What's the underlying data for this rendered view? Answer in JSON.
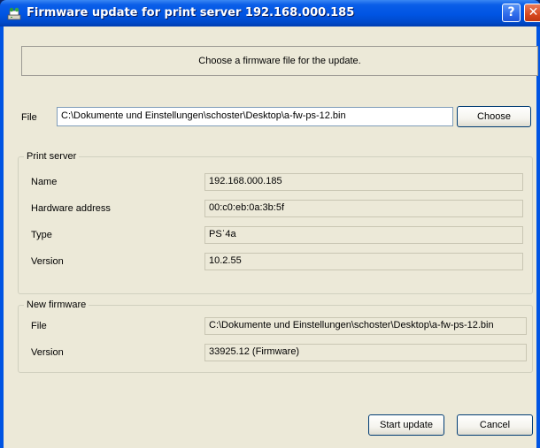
{
  "window": {
    "title": "Firmware update for print server 192.168.000.185",
    "help_label": "?",
    "close_label": "✕"
  },
  "message": "Choose a firmware file for the update.",
  "file_row": {
    "label": "File",
    "value": "C:\\Dokumente und Einstellungen\\schoster\\Desktop\\a-fw-ps-12.bin",
    "choose_label": "Choose"
  },
  "print_server": {
    "title": "Print server",
    "rows": [
      {
        "label": "Name",
        "value": "192.168.000.185"
      },
      {
        "label": "Hardware address",
        "value": "00:c0:eb:0a:3b:5f"
      },
      {
        "label": "Type",
        "value": "PSʿ4a"
      },
      {
        "label": "Version",
        "value": "10.2.55"
      }
    ]
  },
  "new_firmware": {
    "title": "New firmware",
    "rows": [
      {
        "label": "File",
        "value": "C:\\Dokumente und Einstellungen\\schoster\\Desktop\\a-fw-ps-12.bin"
      },
      {
        "label": "Version",
        "value": "33925.12  (Firmware)"
      }
    ]
  },
  "buttons": {
    "start_label": "Start update",
    "cancel_label": "Cancel"
  },
  "colors": {
    "title_bar": "#0054e3",
    "dialog_bg": "#ece9d8",
    "close_button": "#d7491f"
  }
}
